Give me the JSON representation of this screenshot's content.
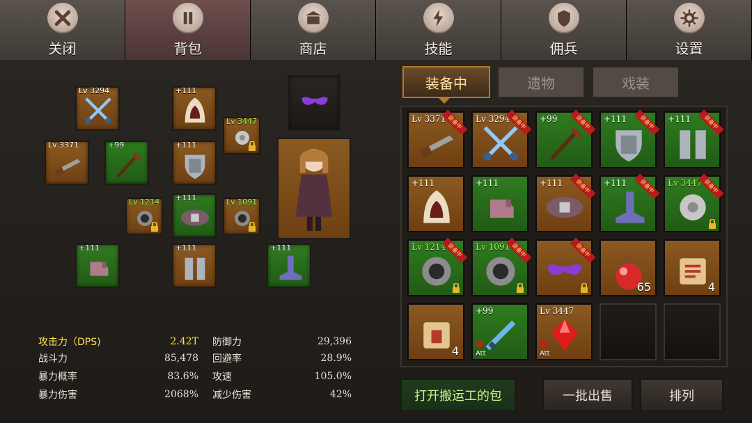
{
  "topnav": {
    "items": [
      {
        "label": "关闭",
        "icon": "close-icon"
      },
      {
        "label": "背包",
        "icon": "bag-icon"
      },
      {
        "label": "商店",
        "icon": "shop-icon"
      },
      {
        "label": "技能",
        "icon": "skill-icon"
      },
      {
        "label": "佣兵",
        "icon": "mercenary-icon"
      },
      {
        "label": "设置",
        "icon": "gear-icon"
      }
    ],
    "active_index": 1
  },
  "character": {
    "slots": [
      {
        "label": "Lv 3294",
        "level_color": "white",
        "item": "crossed-swords-icon"
      },
      {
        "label": "+111",
        "item": "hood-icon"
      },
      {
        "label": "",
        "item": "mask-icon"
      },
      {
        "label": "Lv 3447",
        "level_color": "green",
        "item": "amulet-icon",
        "locked": true
      },
      {
        "label": "Lv 3371",
        "level_color": "white",
        "item": "cannon-icon"
      },
      {
        "label": "+99",
        "item": "staff-icon"
      },
      {
        "label": "+111",
        "item": "armor-icon"
      },
      {
        "label": "Lv 1214",
        "level_color": "green",
        "item": "ring-icon",
        "locked": true
      },
      {
        "label": "+111",
        "item": "belt-icon"
      },
      {
        "label": "Lv 1091",
        "level_color": "green",
        "item": "ring-icon",
        "locked": true
      },
      {
        "label": "+111",
        "item": "gauntlet-icon"
      },
      {
        "label": "+111",
        "item": "greaves-icon"
      },
      {
        "label": "+111",
        "item": "boot-icon"
      }
    ]
  },
  "stats": {
    "rows": [
      {
        "left_label": "攻击力（DPS)",
        "left_value": "2.42T",
        "right_label": "防御力",
        "right_value": "29,396"
      },
      {
        "left_label": "战斗力",
        "left_value": "85,478",
        "right_label": "回避率",
        "right_value": "28.9%"
      },
      {
        "left_label": "暴力概率",
        "left_value": "83.6%",
        "right_label": "攻速",
        "right_value": "105.0%"
      },
      {
        "left_label": "暴力伤害",
        "left_value": "2068%",
        "right_label": "减少伤害",
        "right_value": "42%"
      }
    ]
  },
  "inventory": {
    "tabs": [
      "装备中",
      "遗物",
      "戏装"
    ],
    "active_tab": 0,
    "equipped_badge": "装备中",
    "items": [
      {
        "label": "Lv 3371",
        "item": "cannon-icon",
        "bg": "orange",
        "equipped": true
      },
      {
        "label": "Lv 3294",
        "item": "crossed-swords-icon",
        "bg": "orange",
        "equipped": true
      },
      {
        "label": "+99",
        "item": "staff-icon",
        "bg": "green",
        "equipped": true
      },
      {
        "label": "+111",
        "item": "armor-icon",
        "bg": "green",
        "equipped": true
      },
      {
        "label": "+111",
        "item": "greaves-icon",
        "bg": "green",
        "equipped": true
      },
      {
        "label": "+111",
        "item": "hood-icon",
        "bg": "orange",
        "equipped": false
      },
      {
        "label": "+111",
        "item": "gauntlet-icon",
        "bg": "green",
        "equipped": false
      },
      {
        "label": "+111",
        "item": "belt-icon",
        "bg": "orange",
        "equipped": true
      },
      {
        "label": "+111",
        "item": "boot-icon",
        "bg": "green",
        "equipped": true
      },
      {
        "label": "Lv 3447",
        "item": "amulet-icon",
        "bg": "green",
        "equipped": true,
        "locked": true,
        "level_color": "green"
      },
      {
        "label": "Lv 1214",
        "item": "ring-icon",
        "bg": "green",
        "equipped": true,
        "locked": true,
        "level_color": "green"
      },
      {
        "label": "Lv 1091",
        "item": "ring-icon",
        "bg": "green",
        "equipped": true,
        "locked": true,
        "level_color": "green"
      },
      {
        "label": "",
        "item": "mask-icon",
        "bg": "orange",
        "equipped": true,
        "locked": true
      },
      {
        "label": "",
        "item": "potion-icon",
        "bg": "orange",
        "count": "65"
      },
      {
        "label": "",
        "item": "scroll-icon",
        "bg": "orange",
        "count": "4"
      },
      {
        "label": "",
        "item": "scroll-red-icon",
        "bg": "orange",
        "count": "4"
      },
      {
        "label": "+99",
        "item": "sword-icon",
        "bg": "green",
        "att": "Att",
        "down_arrow": true
      },
      {
        "label": "Lv 3447",
        "item": "gem-icon",
        "bg": "orange",
        "att": "Att",
        "down_arrow": true
      },
      {
        "label": "",
        "item": "empty",
        "bg": "dark"
      },
      {
        "label": "",
        "item": "empty",
        "bg": "dark"
      }
    ]
  },
  "bottom_buttons": {
    "open_transport_bag": "打开搬运工的包",
    "bulk_sell": "一批出售",
    "sort": "排列"
  }
}
